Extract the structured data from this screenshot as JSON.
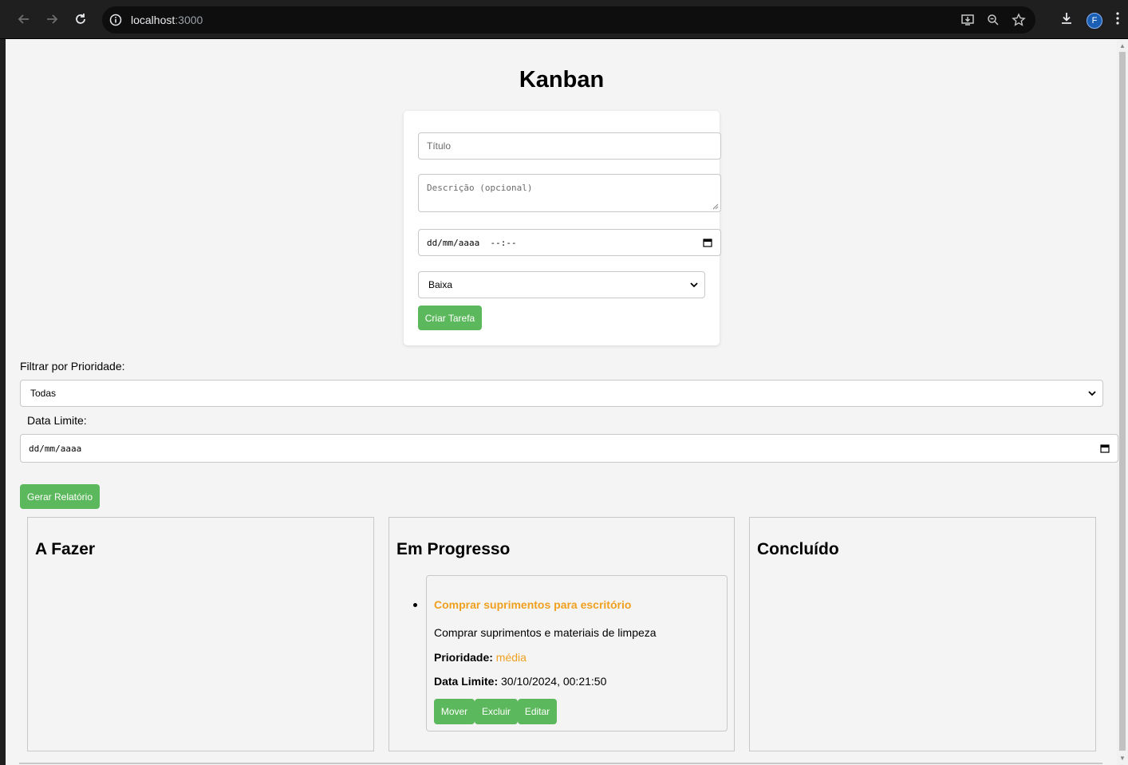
{
  "browser": {
    "url_host": "localhost",
    "url_port": ":3000",
    "profile_initial": "F"
  },
  "page": {
    "title": "Kanban"
  },
  "form": {
    "title_placeholder": "Título",
    "description_placeholder": "Descrição (opcional)",
    "datetime_value": "dd/mm/aaaa  --:--",
    "priority_selected": "Baixa",
    "create_button": "Criar Tarefa"
  },
  "filters": {
    "priority_label": "Filtrar por Prioridade:",
    "priority_selected": "Todas",
    "date_label": "Data Limite:",
    "date_value": "dd/mm/aaaa",
    "report_button": "Gerar Relatório"
  },
  "columns": [
    {
      "title": "A Fazer"
    },
    {
      "title": "Em Progresso"
    },
    {
      "title": "Concluído"
    }
  ],
  "task": {
    "title": "Comprar suprimentos para escritório",
    "description": "Comprar suprimentos e materiais de limpeza",
    "priority_label": "Prioridade:",
    "priority_value": "média",
    "due_label": "Data Limite:",
    "due_value": "30/10/2024, 00:21:50",
    "move_button": "Mover",
    "delete_button": "Excluir",
    "edit_button": "Editar"
  },
  "colors": {
    "accent_green": "#5cb85c",
    "priority_medium": "#f0a020"
  }
}
